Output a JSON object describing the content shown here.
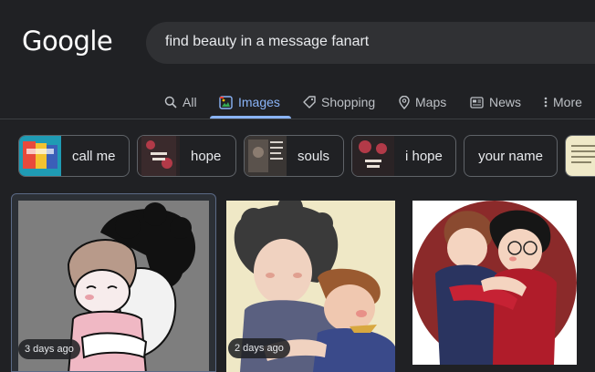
{
  "logo": {
    "text": "Google"
  },
  "search": {
    "query": "find beauty in a message fanart"
  },
  "tabs": [
    {
      "label": "All",
      "icon": "search-icon"
    },
    {
      "label": "Images",
      "icon": "image-icon",
      "active": true
    },
    {
      "label": "Shopping",
      "icon": "tag-icon"
    },
    {
      "label": "Maps",
      "icon": "map-pin-icon"
    },
    {
      "label": "News",
      "icon": "news-icon"
    },
    {
      "label": "More",
      "icon": "kebab-menu-icon"
    }
  ],
  "chips": [
    {
      "label": "call me"
    },
    {
      "label": "hope"
    },
    {
      "label": "souls"
    },
    {
      "label": "i hope"
    },
    {
      "label": "your name"
    }
  ],
  "results": [
    {
      "age": "3 days ago"
    },
    {
      "age": "2 days ago"
    },
    {
      "age": ""
    }
  ],
  "colors": {
    "background": "#202124",
    "accent": "#8ab4f8",
    "search_box": "#303134",
    "chip_border": "#5f6368"
  }
}
